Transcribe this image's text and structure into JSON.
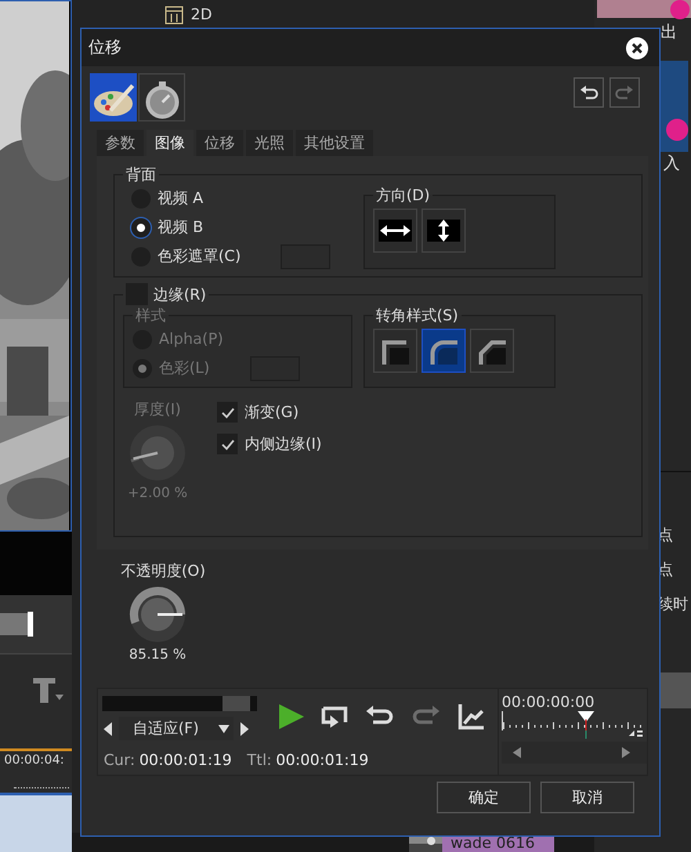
{
  "background_app": {
    "top_item": "2D",
    "right_panel_labels": [
      "出",
      "入",
      "点",
      "点",
      "续时"
    ],
    "timeline_time": "00:00:04:",
    "clip_name": "wade 0616"
  },
  "dialog": {
    "title": "位移",
    "mode_buttons": [
      {
        "kind": "palette",
        "selected": true
      },
      {
        "kind": "stopwatch",
        "selected": false
      }
    ],
    "tabs": [
      {
        "label": "参数",
        "selected": false
      },
      {
        "label": "图像",
        "selected": true
      },
      {
        "label": "位移",
        "selected": false
      },
      {
        "label": "光照",
        "selected": false
      },
      {
        "label": "其他设置",
        "selected": false
      }
    ],
    "background_group": {
      "label": "背面",
      "options": [
        {
          "label": "视频 A",
          "selected": false
        },
        {
          "label": "视频 B",
          "selected": true
        },
        {
          "label": "色彩遮罩(C)",
          "selected": false
        }
      ],
      "direction": {
        "label": "方向(D)",
        "buttons": [
          {
            "kind": "horizontal"
          },
          {
            "kind": "vertical"
          }
        ]
      }
    },
    "border_group": {
      "label": "边缘(R)",
      "checked": false,
      "style": {
        "label": "样式",
        "disabled": true,
        "options": [
          {
            "label": "Alpha(P)",
            "selected": false
          },
          {
            "label": "色彩(L)",
            "selected": true
          }
        ]
      },
      "corner_style": {
        "label": "转角样式(S)",
        "buttons": [
          {
            "kind": "square",
            "selected": false
          },
          {
            "kind": "round",
            "selected": true
          },
          {
            "kind": "bevel",
            "selected": false
          }
        ]
      },
      "thickness": {
        "label": "厚度(I)",
        "reading": "+2.00 %",
        "disabled": true
      },
      "options": [
        {
          "label": "渐变(G)",
          "checked": true
        },
        {
          "label": "内侧边缘(I)",
          "checked": true
        }
      ]
    },
    "opacity": {
      "label": "不透明度(O)",
      "reading": "85.15 %"
    },
    "playback": {
      "zoom_select": "自适应(F)",
      "cur_label": "Cur:",
      "cur_time": "00:00:01:19",
      "ttl_label": "Ttl:",
      "ttl_time": "00:00:01:19",
      "timecode": "00:00:00:00",
      "controls": [
        {
          "kind": "play",
          "disabled": false
        },
        {
          "kind": "loop",
          "disabled": false
        },
        {
          "kind": "undo",
          "disabled": false
        },
        {
          "kind": "redo",
          "disabled": true
        },
        {
          "kind": "graph",
          "disabled": false
        }
      ]
    },
    "buttons": [
      "确定",
      "取消"
    ]
  }
}
